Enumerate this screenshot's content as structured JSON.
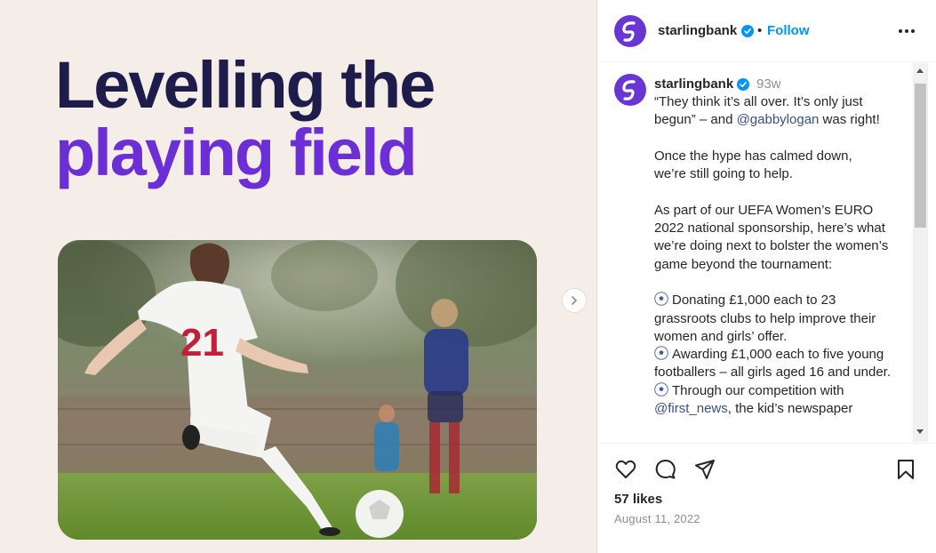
{
  "post_image": {
    "headline_line1": "Levelling the",
    "headline_line2": "playing field",
    "jersey_number": "21"
  },
  "header": {
    "username": "starlingbank",
    "separator": "•",
    "follow_label": "Follow"
  },
  "caption": {
    "username": "starlingbank",
    "age": "93w",
    "intro_a": "“They think it’s all over. It’s only just begun” – and ",
    "mention1": "@gabbylogan",
    "intro_b": " was right!",
    "para2": "Once the hype has calmed down,\nwe’re still going to help.",
    "para3": "As part of our UEFA Women’s EURO 2022 national sponsorship, here’s what we’re doing next to bolster the women’s game beyond the tournament:",
    "item1": "Donating £1,000 each to 23 grassroots clubs to help improve their women and girls’ offer.",
    "item2": "Awarding £1,000 each to five young footballers – all girls aged 16 and under.",
    "item3a": "Through our competition with ",
    "mention2": "@first_news",
    "item3b": ", the kid’s newspaper"
  },
  "footer": {
    "likes": "57 likes",
    "date": "August 11, 2022"
  },
  "colors": {
    "brand_purple": "#6935d3",
    "headline_navy": "#1e1c4a",
    "headline_purple": "#6c2fd6",
    "link_blue": "#0095f6",
    "mention_blue": "#385185"
  }
}
